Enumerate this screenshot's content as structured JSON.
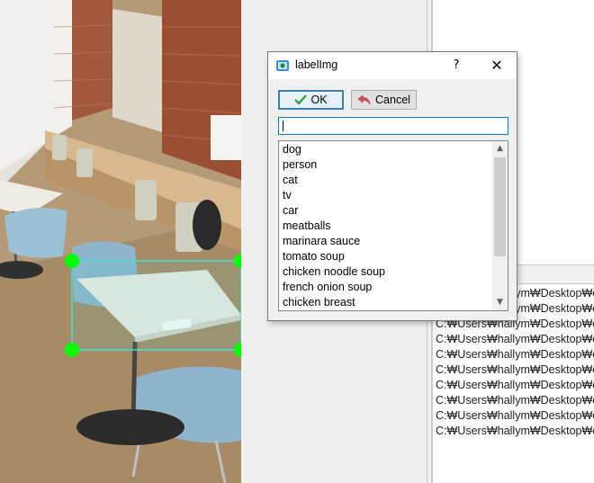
{
  "dialog": {
    "title": "labelImg",
    "help_label": "?",
    "close_label": "✕",
    "ok_label": "OK",
    "cancel_label": "Cancel",
    "input_value": "",
    "labels": [
      "dog",
      "person",
      "cat",
      "tv",
      "car",
      "meatballs",
      "marinara sauce",
      "tomato soup",
      "chicken noodle soup",
      "french onion soup",
      "chicken breast"
    ]
  },
  "file_list": {
    "items": [
      "C:₩Users₩hallym₩Desktop₩caps",
      "C:₩Users₩hallym₩Desktop₩caps",
      "C:₩Users₩hallym₩Desktop₩caps",
      "C:₩Users₩hallym₩Desktop₩caps",
      "C:₩Users₩hallym₩Desktop₩caps",
      "C:₩Users₩hallym₩Desktop₩caps",
      "C:₩Users₩hallym₩Desktop₩caps",
      "C:₩Users₩hallym₩Desktop₩caps",
      "C:₩Users₩hallym₩Desktop₩caps",
      "C:₩Users₩hallym₩Desktop₩caps"
    ]
  },
  "colors": {
    "bbox_outline": "#40e0d0",
    "bbox_handle": "#00ff00",
    "ok_border": "#3c7fb1"
  }
}
